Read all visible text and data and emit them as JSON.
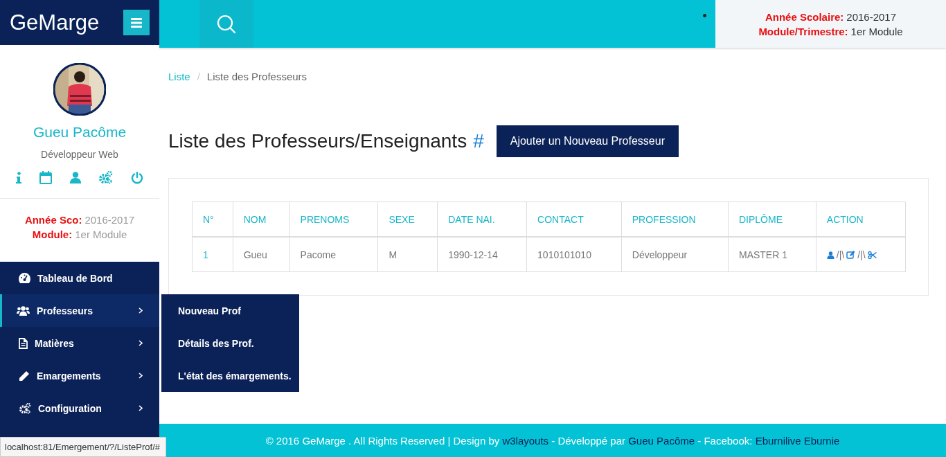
{
  "brand": {
    "title": "GeMarge"
  },
  "profile": {
    "name": "Gueu Pacôme",
    "role": "Développeur Web"
  },
  "sidebar_info": [
    {
      "label": "Année Sco:",
      "value": "2016-2017"
    },
    {
      "label": "Module:",
      "value": "1er Module"
    }
  ],
  "nav": {
    "items": [
      {
        "label": "Tableau de Bord",
        "selected": false,
        "expandable": false
      },
      {
        "label": "Professeurs",
        "selected": true,
        "expandable": true,
        "submenu": [
          "Nouveau Prof",
          "Détails des Prof.",
          "L'état des émargements."
        ]
      },
      {
        "label": "Matières",
        "selected": false,
        "expandable": true
      },
      {
        "label": "Emargements",
        "selected": false,
        "expandable": true
      },
      {
        "label": "Configuration",
        "selected": false,
        "expandable": true
      }
    ]
  },
  "header_info": [
    {
      "label": "Année Scolaire:",
      "value": "2016-2017"
    },
    {
      "label": "Module/Trimestre:",
      "value": "1er Module"
    }
  ],
  "breadcrumb": {
    "items": [
      "Liste",
      "Liste des Professeurs"
    ],
    "separator": "/"
  },
  "page_title": {
    "text": "Liste des Professeurs/Enseignants",
    "mark": "#"
  },
  "add_button": "Ajouter un Nouveau Professeur",
  "table": {
    "columns": [
      "N°",
      "NOM",
      "PRENOMS",
      "SEXE",
      "DATE NAI.",
      "CONTACT",
      "PROFESSION",
      "DIPLÔME",
      "ACTION"
    ],
    "rows": [
      {
        "cells": [
          "1",
          "Gueu",
          "Pacome",
          "M",
          "1990-12-14",
          "1010101010",
          "Développeur",
          "MASTER 1"
        ],
        "action_separators": [
          "/|\\",
          "/|\\"
        ]
      }
    ]
  },
  "footer": {
    "parts": [
      {
        "text": "© 2016 GeMarge . All Rights Reserved | Design by ",
        "link": false
      },
      {
        "text": "w3layouts",
        "link": true
      },
      {
        "text": " - Développé par ",
        "link": false
      },
      {
        "text": "Gueu Pacôme",
        "link": true
      },
      {
        "text": " - Facebook: ",
        "link": false
      },
      {
        "text": "Eburnilive Eburnie",
        "link": true
      }
    ]
  },
  "status_url": "localhost:81/Emergement/?/ListeProf/#"
}
